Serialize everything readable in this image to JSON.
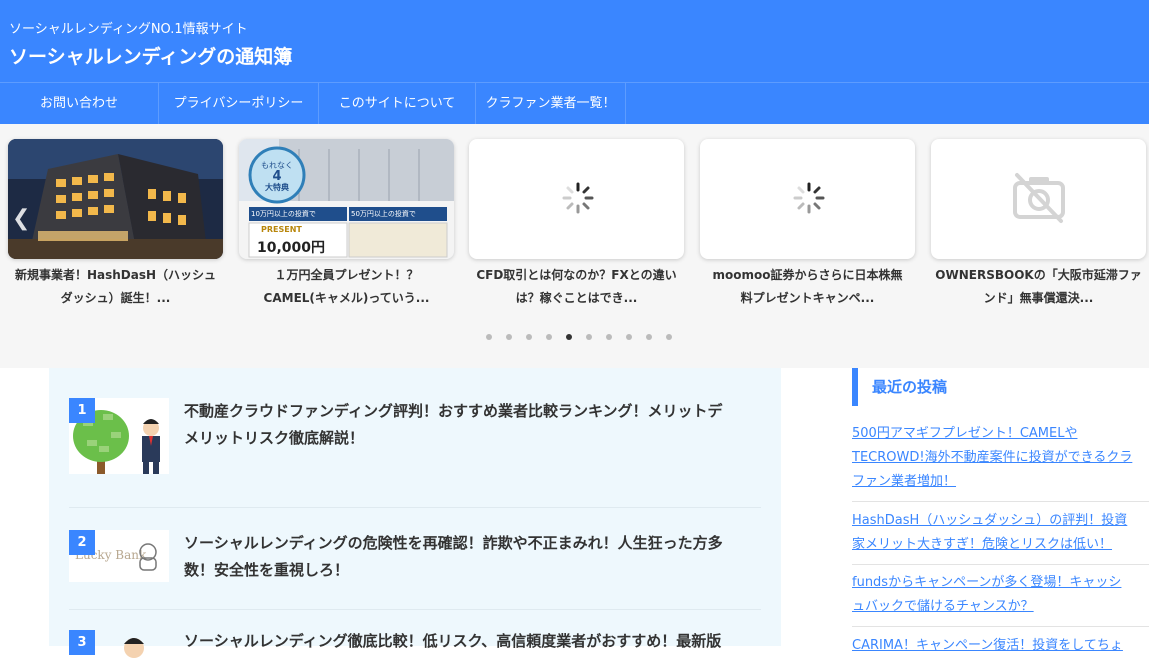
{
  "header": {
    "tagline": "ソーシャルレンディングNO.1情報サイト",
    "site_title": "ソーシャルレンディングの通知簿"
  },
  "nav": {
    "items": [
      "お問い合わせ",
      "プライバシーポリシー",
      "このサイトについて",
      "クラファン業者一覧！"
    ]
  },
  "carousel": {
    "cards": [
      {
        "caption_line1": "新規事業者！HashDasH（ハッシュ",
        "caption_line2": "ダッシュ）誕生！..."
      },
      {
        "caption_line1": "１万円全員プレゼント！？",
        "caption_line2": "CAMEL(キャメル)っていう..."
      },
      {
        "caption_line1": "CFD取引とは何なのか？FXとの違い",
        "caption_line2": "は？稼ぐことはでき..."
      },
      {
        "caption_line1": "moomoo証券からさらに日本株無",
        "caption_line2": "料プレゼントキャンペ..."
      },
      {
        "caption_line1": "OWNERSBOOKの「大阪市延滞ファ",
        "caption_line2": "ンド」無事償還決..."
      }
    ],
    "card2_image": {
      "badge_line1": "もれなく",
      "badge_line2": "4",
      "badge_line3": "大特典",
      "banner_left": "10万円以上の投資で",
      "banner_right": "50万円以上の投資で",
      "present_label": "PRESENT",
      "amount": "10,000円"
    },
    "dots_total": 10,
    "active_dot_index": 4
  },
  "ranking": {
    "items": [
      {
        "rank": "1",
        "title_line1": "不動産クラウドファンディング評判！おすすめ業者比較ランキング！メリットデ",
        "title_line2": "メリットリスク徹底解説！"
      },
      {
        "rank": "2",
        "title_line1": "ソーシャルレンディングの危険性を再確認！詐欺や不正まみれ！人生狂った方多",
        "title_line2": "数！安全性を重視しろ！",
        "thumb_text": "Lucky Bank"
      },
      {
        "rank": "3",
        "title_line1": "ソーシャルレンディング徹底比較！低リスク、高信頼度業者がおすすめ！最新版",
        "title_line2": ""
      }
    ]
  },
  "sidebar": {
    "heading": "最近の投稿",
    "posts": [
      {
        "line1": "500円アマギフプレゼント！CAMELや",
        "line2": "TECROWD!海外不動産案件に投資ができるクラ",
        "line3": "ファン業者増加！"
      },
      {
        "line1": "HashDasH（ハッシュダッシュ）の評判！投資",
        "line2": "家メリット大きすぎ！危険とリスクは低い！"
      },
      {
        "line1": "fundsからキャンペーンが多く登場！キャッシ",
        "line2": "ュバックで儲けるチャンスか？"
      },
      {
        "line1": "CARIMA！キャンペーン復活！投資をしてちょ"
      }
    ]
  },
  "colors": {
    "brand": "#3a86ff",
    "panel_bg": "#eef8fd",
    "carousel_bg": "#f6f6f6"
  },
  "icons": {
    "prev": "chevron-left-icon",
    "next": "chevron-right-icon",
    "loading": "loading-spinner-icon",
    "no_image": "no-image-icon"
  }
}
